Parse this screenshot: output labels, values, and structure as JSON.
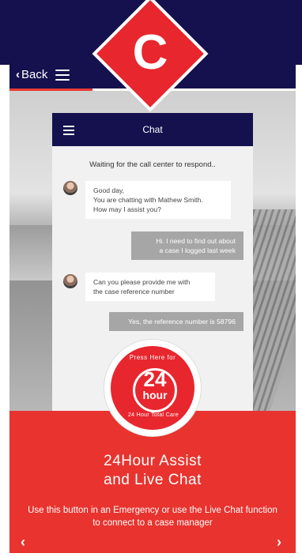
{
  "header": {
    "back_label": "Back",
    "title": "",
    "brand_letter": "C"
  },
  "chat": {
    "title": "Chat",
    "waiting_text": "Waiting for the call center to respond..",
    "messages": [
      {
        "from": "agent",
        "text": "Good day,\nYou are chatting with Mathew Smith.\nHow may I assist you?"
      },
      {
        "from": "user",
        "text": "Hi. I need to find out about\na case I logged last week"
      },
      {
        "from": "agent",
        "text": "Can you please provide me with\nthe case reference number"
      },
      {
        "from": "user",
        "text": "Yes, the reference number is 58796"
      }
    ]
  },
  "badge": {
    "top_text": "Press Here for",
    "number": "24",
    "unit": "hour",
    "bottom_text": "24 Hour Total Care"
  },
  "panel": {
    "title_line1": "24Hour Assist",
    "title_line2": "and Live Chat",
    "description": "Use this button in an Emergency or use the Live Chat function to connect to a case manager",
    "prev_label": "‹",
    "next_label": "›"
  },
  "colors": {
    "navy": "#14114e",
    "red": "#e8332e",
    "bubble_out": "#a6a6a6"
  },
  "icons": [
    "back-chevron-icon",
    "menu-icon",
    "brand-logo",
    "avatar-icon",
    "arrow-left-icon",
    "arrow-right-icon"
  ]
}
